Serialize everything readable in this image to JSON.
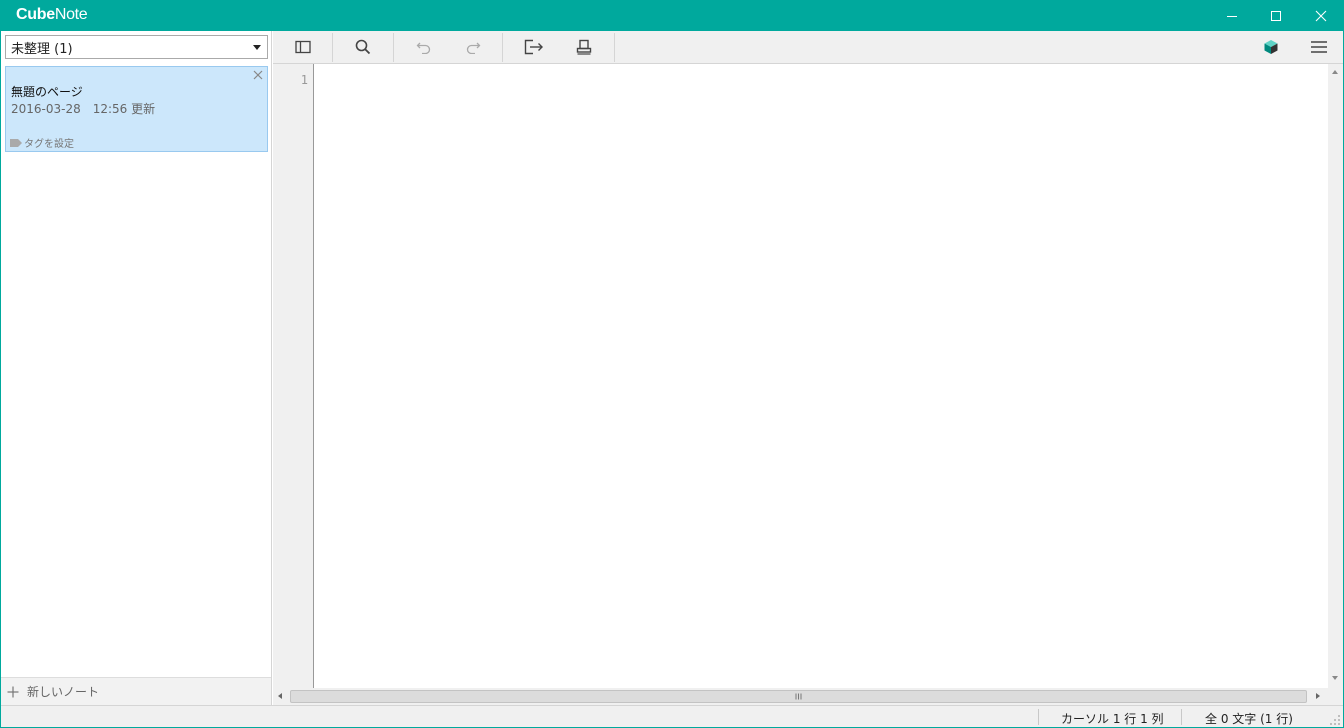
{
  "app": {
    "title_bold": "Cube",
    "title_light": "Note"
  },
  "window_controls": {
    "minimize": "minimize-icon",
    "maximize": "maximize-icon",
    "close": "close-icon"
  },
  "sidebar": {
    "folder_selected": "未整理 (1)",
    "notes": [
      {
        "title": "無題のページ",
        "updated": "2016-03-28　12:56 更新",
        "tag_label": "タグを設定"
      }
    ],
    "new_note_label": "新しいノート"
  },
  "toolbar": {
    "icons": [
      "sidebar-toggle-icon",
      "search-icon",
      "undo-icon",
      "redo-icon",
      "export-icon",
      "print-icon",
      "cube-icon",
      "menu-icon"
    ]
  },
  "editor": {
    "line_number": "1"
  },
  "status": {
    "cursor": "カーソル 1 行 1 列",
    "count": "全 0 文字 (1 行)"
  },
  "colors": {
    "accent": "#00a99d",
    "selected_note": "#cce7fb",
    "toolbar_bg": "#f0f0f0"
  }
}
